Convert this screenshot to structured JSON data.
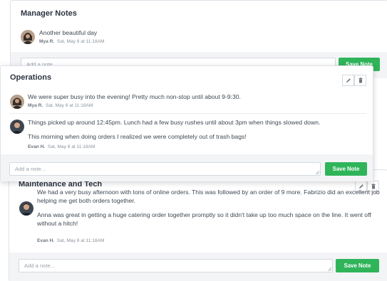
{
  "manager_notes": {
    "title": "Manager Notes",
    "notes": [
      {
        "author": "Mya R.",
        "date": "Sat, May 8 at 11:18AM",
        "text": "Another beautiful day"
      }
    ],
    "input_placeholder": "Add a note...",
    "save_label": "Save Note"
  },
  "operations": {
    "title": "Operations",
    "notes": [
      {
        "author": "Mya R.",
        "date": "Sat, May 8 at 11:18AM",
        "text": "We were super busy into the evening! Pretty much non-stop until about 9-9:30."
      },
      {
        "author": "Evan H.",
        "date": "Sat, May 8 at 11:18AM",
        "text1": "Things picked up around 12:45pm. Lunch had a few busy rushes until about 3pm when things slowed down.",
        "text2": "This morning when doing orders I realized we were completely out of trash bags!"
      }
    ],
    "input_placeholder": "Add a note...",
    "save_label": "Save Note",
    "edit_icon": "pencil-icon",
    "delete_icon": "trash-icon"
  },
  "maintenance": {
    "title": "Maintenance and Tech",
    "notes": [
      {
        "author": "Evan H.",
        "date": "Sat, May 8 at 11:18AM",
        "line1": "We had a very busy afternoon with tons of online orders. This was followed by an order of 9 more. Fabrizio did an excellent job",
        "line2": "helping me get both orders together.",
        "line3": "Anna was great in getting a huge catering order together promptly so it didn't take up too much space on the line. It went off",
        "line4": "without a hitch!"
      }
    ],
    "input_placeholder": "Add a note...",
    "save_label": "Save Note",
    "edit_icon": "pencil-icon",
    "delete_icon": "trash-icon"
  },
  "colors": {
    "accent": "#2fb45a",
    "border": "#dfe3e8",
    "band": "#f3f4f6"
  }
}
